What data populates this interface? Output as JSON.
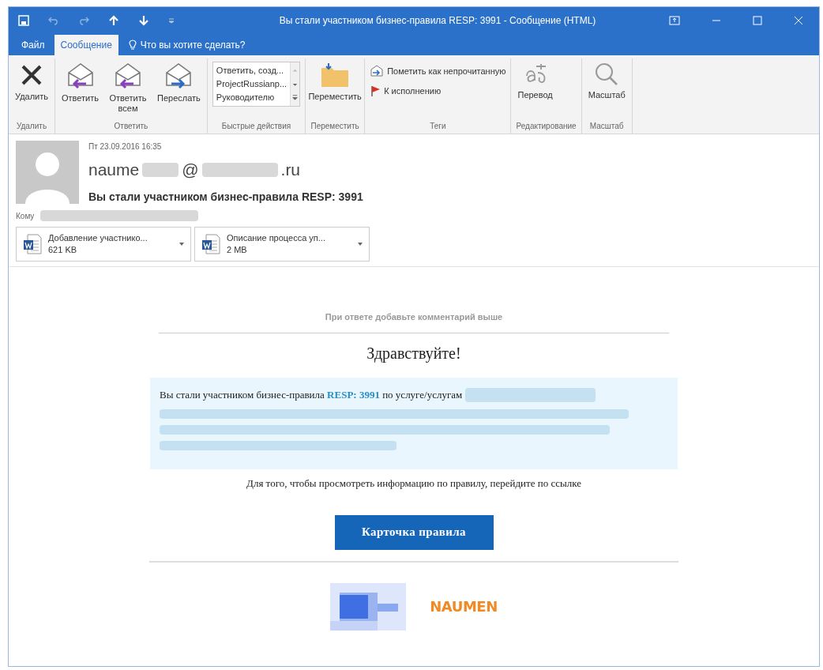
{
  "window": {
    "title": "Вы стали участником бизнес-правила RESP: 3991 - Сообщение (HTML)"
  },
  "tabs": [
    {
      "label": "Файл",
      "selected": false
    },
    {
      "label": "Сообщение",
      "selected": true
    }
  ],
  "tell_me": {
    "placeholder": "Что вы хотите сделать?"
  },
  "ribbon": {
    "groups": [
      {
        "label": "Удалить",
        "buttons": [
          {
            "label": "Удалить",
            "kind": "delete"
          }
        ]
      },
      {
        "label": "Ответить",
        "buttons": [
          {
            "label": "Ответить",
            "kind": "reply"
          },
          {
            "label": "Ответить всем",
            "kind": "reply"
          },
          {
            "label": "Переслать",
            "kind": "forward"
          }
        ]
      },
      {
        "label": "Быстрые действия",
        "quick_steps": [
          "Ответить, созд...",
          "ProjectRussianp...",
          "Руководителю"
        ]
      },
      {
        "label": "Переместить",
        "buttons": [
          {
            "label": "Переместить",
            "kind": "folder"
          }
        ]
      },
      {
        "label": "Теги",
        "small_buttons": [
          {
            "label": "Пометить как непрочитанную",
            "kind": "unread"
          },
          {
            "label": "К исполнению",
            "kind": "flag"
          }
        ]
      },
      {
        "label": "Редактирование",
        "buttons": [
          {
            "label": "Перевод",
            "kind": "translate"
          }
        ]
      },
      {
        "label": "Масштаб",
        "buttons": [
          {
            "label": "Масштаб",
            "kind": "zoom"
          }
        ]
      }
    ]
  },
  "message": {
    "date": "Пт 23.09.2016 16:35",
    "sender_parts": [
      "naume",
      "@",
      ".ru"
    ],
    "subject": "Вы стали участником бизнес-правила RESP: 3991",
    "to_label": "Кому",
    "attachments": [
      {
        "name": "Добавление участнико...",
        "size": "621 KB"
      },
      {
        "name": "Описание процесса уп...",
        "size": "2 MB"
      }
    ]
  },
  "body": {
    "reply_note": "При ответе добавьте комментарий выше",
    "greeting": "Здравствуйте!",
    "info": "Вы стали участником бизнес-правила **RESP: 3991** по услуге/услугам",
    "instruction": "Для того, чтобы просмотреть информацию по правилу, перейдите по ссылке",
    "button": "Карточка правила",
    "logo_text": "NAUMEN"
  }
}
